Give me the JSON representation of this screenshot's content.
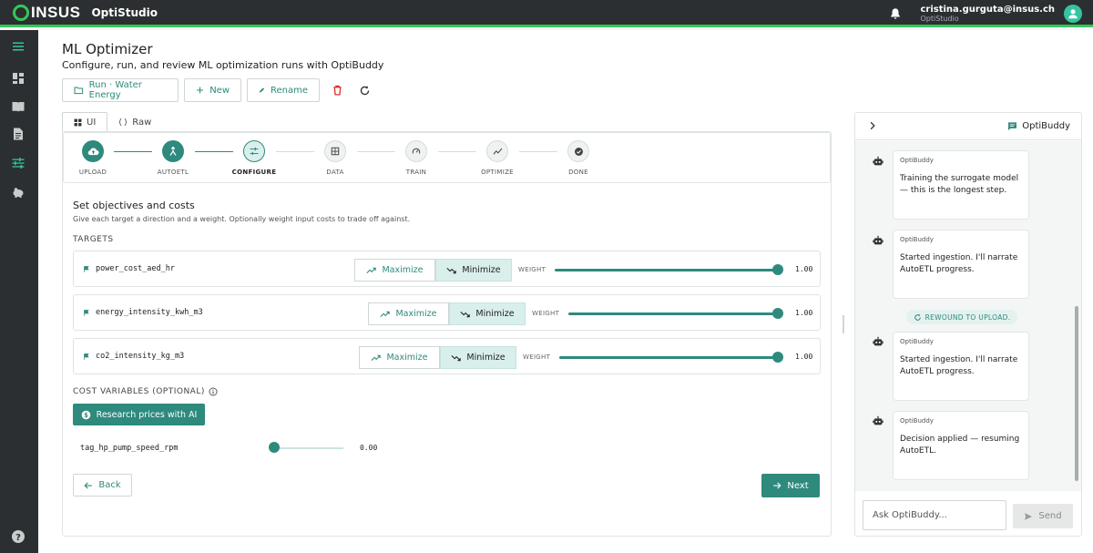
{
  "topbar": {
    "logo_text": "INSUS",
    "app_name": "OptiStudio",
    "user_email": "cristina.gurguta@insus.ch",
    "user_org": "OptiStudio"
  },
  "page": {
    "title": "ML Optimizer",
    "subtitle": "Configure, run, and review ML optimization runs with OptiBuddy"
  },
  "toolbar": {
    "run_label": "Run · Water Energy",
    "new_label": "New",
    "rename_label": "Rename"
  },
  "tabs": [
    {
      "label": "UI"
    },
    {
      "label": "Raw"
    }
  ],
  "stepper": {
    "steps": [
      {
        "label": "UPLOAD"
      },
      {
        "label": "AUTOETL"
      },
      {
        "label": "CONFIGURE"
      },
      {
        "label": "DATA"
      },
      {
        "label": "TRAIN"
      },
      {
        "label": "OPTIMIZE"
      },
      {
        "label": "DONE"
      }
    ]
  },
  "objectives": {
    "title": "Set objectives and costs",
    "subtitle": "Give each target a direction and a weight. Optionally weight input costs to trade off against.",
    "targets_label": "TARGETS",
    "maximize_label": "Maximize",
    "minimize_label": "Minimize",
    "weight_label": "WEIGHT",
    "targets": [
      {
        "name": "power_cost_aed_hr",
        "weight": "1.00",
        "direction": "Minimize"
      },
      {
        "name": "energy_intensity_kwh_m3",
        "weight": "1.00",
        "direction": "Minimize"
      },
      {
        "name": "co2_intensity_kg_m3",
        "weight": "1.00",
        "direction": "Minimize"
      }
    ]
  },
  "costs": {
    "label": "COST VARIABLES (OPTIONAL)",
    "research_label": "Research prices with AI",
    "variables": [
      {
        "name": "tag_hp_pump_speed_rpm",
        "value": "0.00"
      }
    ]
  },
  "nav": {
    "back_label": "Back",
    "next_label": "Next"
  },
  "chat": {
    "title": "OptiBuddy",
    "messages": [
      {
        "sender": "OptiBuddy",
        "text": "Training the surrogate model — this is the longest step."
      },
      {
        "sender": "OptiBuddy",
        "text": "Started ingestion. I'll narrate AutoETL progress."
      },
      {
        "sender": "OptiBuddy",
        "text": "Started ingestion. I'll narrate AutoETL progress."
      },
      {
        "sender": "OptiBuddy",
        "text": "Decision applied — resuming AutoETL."
      }
    ],
    "rewound_label": "REWOUND TO UPLOAD.",
    "input_placeholder": "Ask OptiBuddy...",
    "send_label": "Send"
  },
  "colors": {
    "accent": "#2e8a7d",
    "accent_light": "#d9efec",
    "topbar": "#2b2f31",
    "brand_green": "#34c759",
    "delete_red": "#d93025"
  }
}
